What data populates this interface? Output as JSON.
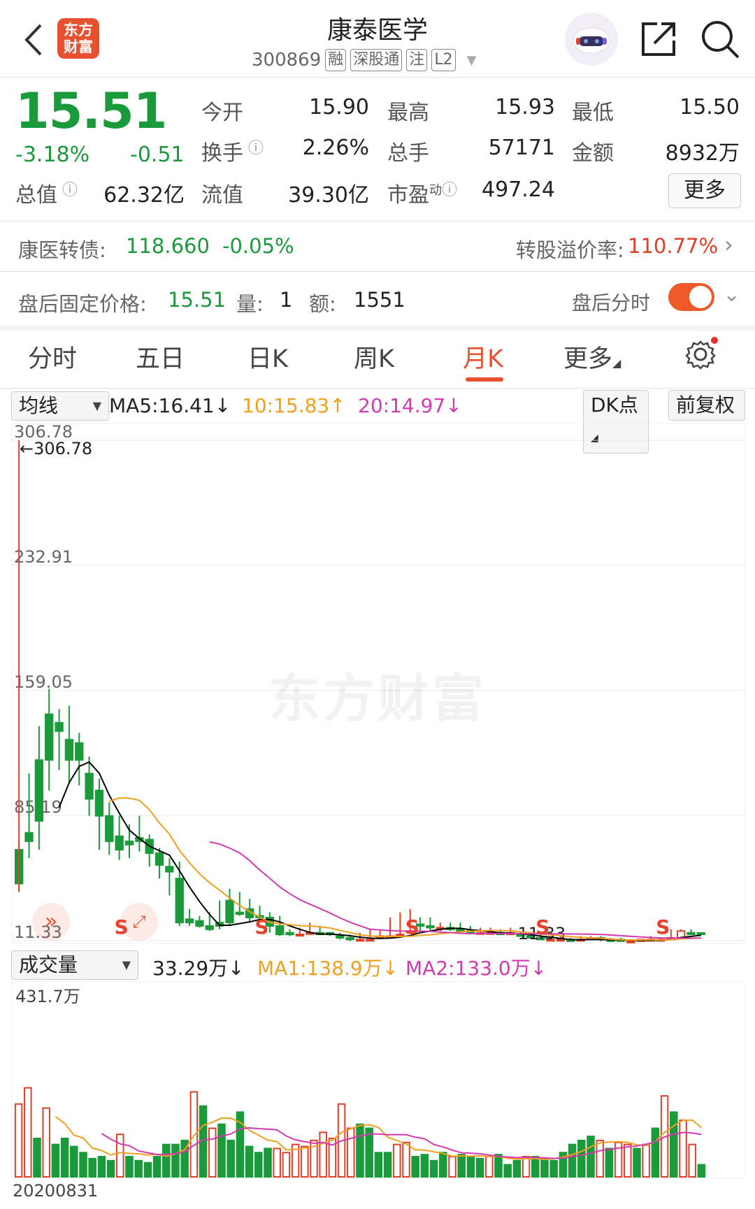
{
  "header": {
    "logo_text": "东方财富",
    "title": "康泰医学",
    "code": "300869",
    "tags": [
      "融",
      "深股通",
      "注",
      "L2"
    ]
  },
  "quote": {
    "price": "15.51",
    "change_pct": "-3.18%",
    "change": "-0.51",
    "open_label": "今开",
    "open": "15.90",
    "high_label": "最高",
    "high": "15.93",
    "low_label": "最低",
    "low": "15.50",
    "turnover_label": "换手",
    "turnover": "2.26%",
    "volume_label": "总手",
    "volume": "57171",
    "amount_label": "金额",
    "amount": "8932万",
    "mktcap_label": "总值",
    "mktcap": "62.32亿",
    "float_label": "流值",
    "float": "39.30亿",
    "pe_label": "市盈",
    "pe_sup": "动",
    "pe": "497.24",
    "more_button": "更多"
  },
  "bond": {
    "name": "康医转债:",
    "price": "118.660",
    "change": "-0.05%",
    "premium_label": "转股溢价率:",
    "premium": "110.77%"
  },
  "afterhours": {
    "label": "盘后固定价格:",
    "price": "15.51",
    "vol_label": "量:",
    "vol": "1",
    "amt_label": "额:",
    "amt": "1551",
    "switch_label": "盘后分时"
  },
  "tabs": [
    "分时",
    "五日",
    "日K",
    "周K",
    "月K",
    "更多"
  ],
  "active_tab": "月K",
  "indicator": {
    "selector": "均线",
    "ma5": "MA5:16.41↓",
    "ma10": "10:15.83↑",
    "ma20": "20:14.97↓",
    "dk_button": "DK点",
    "adjust_button": "前复权"
  },
  "volume_indicator": {
    "selector": "成交量",
    "current": "33.29万↓",
    "ma1": "MA1:138.9万↓",
    "ma2": "MA2:133.0万↓",
    "max_label": "431.7万",
    "date_label": "20200831"
  },
  "watermark": "东方财富",
  "colors": {
    "up": "#e0402a",
    "down": "#1a9a3a",
    "ma5": "#000000",
    "ma10": "#f0a020",
    "ma20": "#d23ab0",
    "accent": "#e8502f"
  },
  "icons": {
    "back": "chevron-left-icon",
    "robot": "robot-avatar-icon",
    "share": "share-icon",
    "search": "search-icon",
    "settings": "gear-icon"
  },
  "chart_data": [
    {
      "type": "candlestick",
      "title": "月K",
      "y_ticks": [
        "306.78",
        "232.91",
        "159.05",
        "85.19",
        "11.33"
      ],
      "ylim": [
        11.33,
        306.78
      ],
      "max_annotation": "←306.78",
      "min_annotation": "11.33",
      "grid": true,
      "candles": [
        [
          65,
          70,
          45,
          40
        ],
        [
          75,
          110,
          70,
          60
        ],
        [
          118,
          138,
          82,
          65
        ],
        [
          145,
          160,
          118,
          100
        ],
        [
          140,
          148,
          135,
          112
        ],
        [
          130,
          150,
          118,
          105
        ],
        [
          128,
          134,
          118,
          103
        ],
        [
          110,
          120,
          95,
          85
        ],
        [
          100,
          107,
          85,
          65
        ],
        [
          85,
          93,
          70,
          62
        ],
        [
          73,
          85,
          65,
          59
        ],
        [
          70,
          80,
          68,
          60
        ],
        [
          72,
          85,
          70,
          64
        ],
        [
          71,
          74,
          63,
          55
        ],
        [
          63,
          66,
          56,
          48
        ],
        [
          55,
          60,
          52,
          38
        ],
        [
          48,
          58,
          22,
          20
        ],
        [
          24,
          30,
          22,
          20
        ],
        [
          23,
          26,
          20,
          19
        ],
        [
          20,
          28,
          18,
          17
        ],
        [
          22,
          35,
          20,
          18
        ],
        [
          35,
          42,
          22,
          20
        ],
        [
          28,
          40,
          27,
          26
        ],
        [
          30,
          36,
          25,
          22
        ],
        [
          26,
          32,
          25,
          23
        ],
        [
          25,
          28,
          20,
          16
        ],
        [
          20,
          26,
          15,
          14
        ],
        [
          16,
          18,
          15,
          14
        ],
        [
          15,
          19,
          15,
          14
        ],
        [
          16,
          22,
          16,
          15
        ],
        [
          16,
          20,
          15,
          15
        ],
        [
          16,
          16,
          15,
          14
        ],
        [
          14,
          16,
          13,
          12
        ],
        [
          13,
          15,
          12,
          11
        ],
        [
          12,
          16,
          12,
          11
        ],
        [
          12,
          18,
          12,
          11
        ],
        [
          13,
          18,
          14,
          13
        ],
        [
          14,
          25,
          14,
          13
        ],
        [
          15,
          28,
          15,
          14
        ],
        [
          17,
          30,
          17,
          16
        ],
        [
          21,
          25,
          20,
          17
        ],
        [
          20,
          25,
          19,
          17
        ],
        [
          19,
          22,
          19,
          17
        ],
        [
          19,
          22,
          18,
          17
        ],
        [
          18,
          22,
          17,
          17
        ],
        [
          17,
          20,
          16,
          15
        ],
        [
          16,
          19,
          16,
          15
        ],
        [
          16,
          19,
          16,
          15
        ],
        [
          16,
          18,
          15,
          15
        ],
        [
          15,
          19,
          16,
          15
        ],
        [
          15,
          17,
          14,
          14
        ],
        [
          14,
          16,
          13,
          13
        ],
        [
          13,
          15,
          12,
          12
        ],
        [
          12,
          14,
          12,
          11
        ],
        [
          12,
          14,
          12,
          11
        ],
        [
          12,
          13,
          11,
          11
        ],
        [
          12,
          14,
          12,
          11
        ],
        [
          12,
          14,
          13,
          12
        ],
        [
          13,
          14,
          12,
          11
        ],
        [
          12,
          13,
          11,
          11
        ],
        [
          12,
          13,
          11,
          11
        ],
        [
          11,
          12,
          11,
          11
        ],
        [
          11,
          12,
          12,
          11
        ],
        [
          12,
          14,
          12,
          11
        ],
        [
          12,
          13,
          12,
          11
        ],
        [
          12,
          18,
          13,
          12
        ],
        [
          13,
          18,
          17,
          13
        ],
        [
          16,
          18,
          15,
          15
        ],
        [
          15.9,
          15.93,
          15.51,
          15.5
        ]
      ],
      "signals": [
        "S",
        "S",
        "S",
        "S",
        "S"
      ]
    },
    {
      "type": "bar",
      "title": "成交量",
      "ylim": [
        0,
        431.7
      ],
      "values": [
        180,
        220,
        95,
        170,
        80,
        95,
        75,
        60,
        45,
        50,
        40,
        105,
        50,
        40,
        35,
        50,
        80,
        80,
        90,
        210,
        175,
        120,
        130,
        90,
        160,
        75,
        60,
        70,
        70,
        60,
        80,
        75,
        90,
        110,
        95,
        180,
        120,
        130,
        120,
        60,
        60,
        80,
        85,
        50,
        55,
        40,
        60,
        50,
        55,
        50,
        45,
        50,
        55,
        30,
        40,
        50,
        50,
        45,
        40,
        60,
        80,
        90,
        100,
        90,
        70,
        85,
        80,
        70,
        80,
        120,
        200,
        160,
        140,
        80,
        30
      ],
      "directions": [
        "u",
        "u",
        "d",
        "u",
        "d",
        "d",
        "d",
        "d",
        "d",
        "d",
        "d",
        "u",
        "d",
        "d",
        "d",
        "d",
        "d",
        "d",
        "d",
        "u",
        "d",
        "u",
        "d",
        "d",
        "d",
        "d",
        "d",
        "d",
        "u",
        "u",
        "u",
        "u",
        "u",
        "u",
        "u",
        "u",
        "u",
        "d",
        "d",
        "d",
        "d",
        "u",
        "u",
        "d",
        "d",
        "d",
        "d",
        "u",
        "d",
        "d",
        "d",
        "u",
        "d",
        "d",
        "d",
        "u",
        "d",
        "d",
        "d",
        "d",
        "d",
        "d",
        "d",
        "u",
        "d",
        "u",
        "u",
        "d",
        "u",
        "d",
        "u",
        "d",
        "u",
        "u",
        "d"
      ],
      "annotations": [
        "431.7万",
        "20200831"
      ]
    }
  ]
}
